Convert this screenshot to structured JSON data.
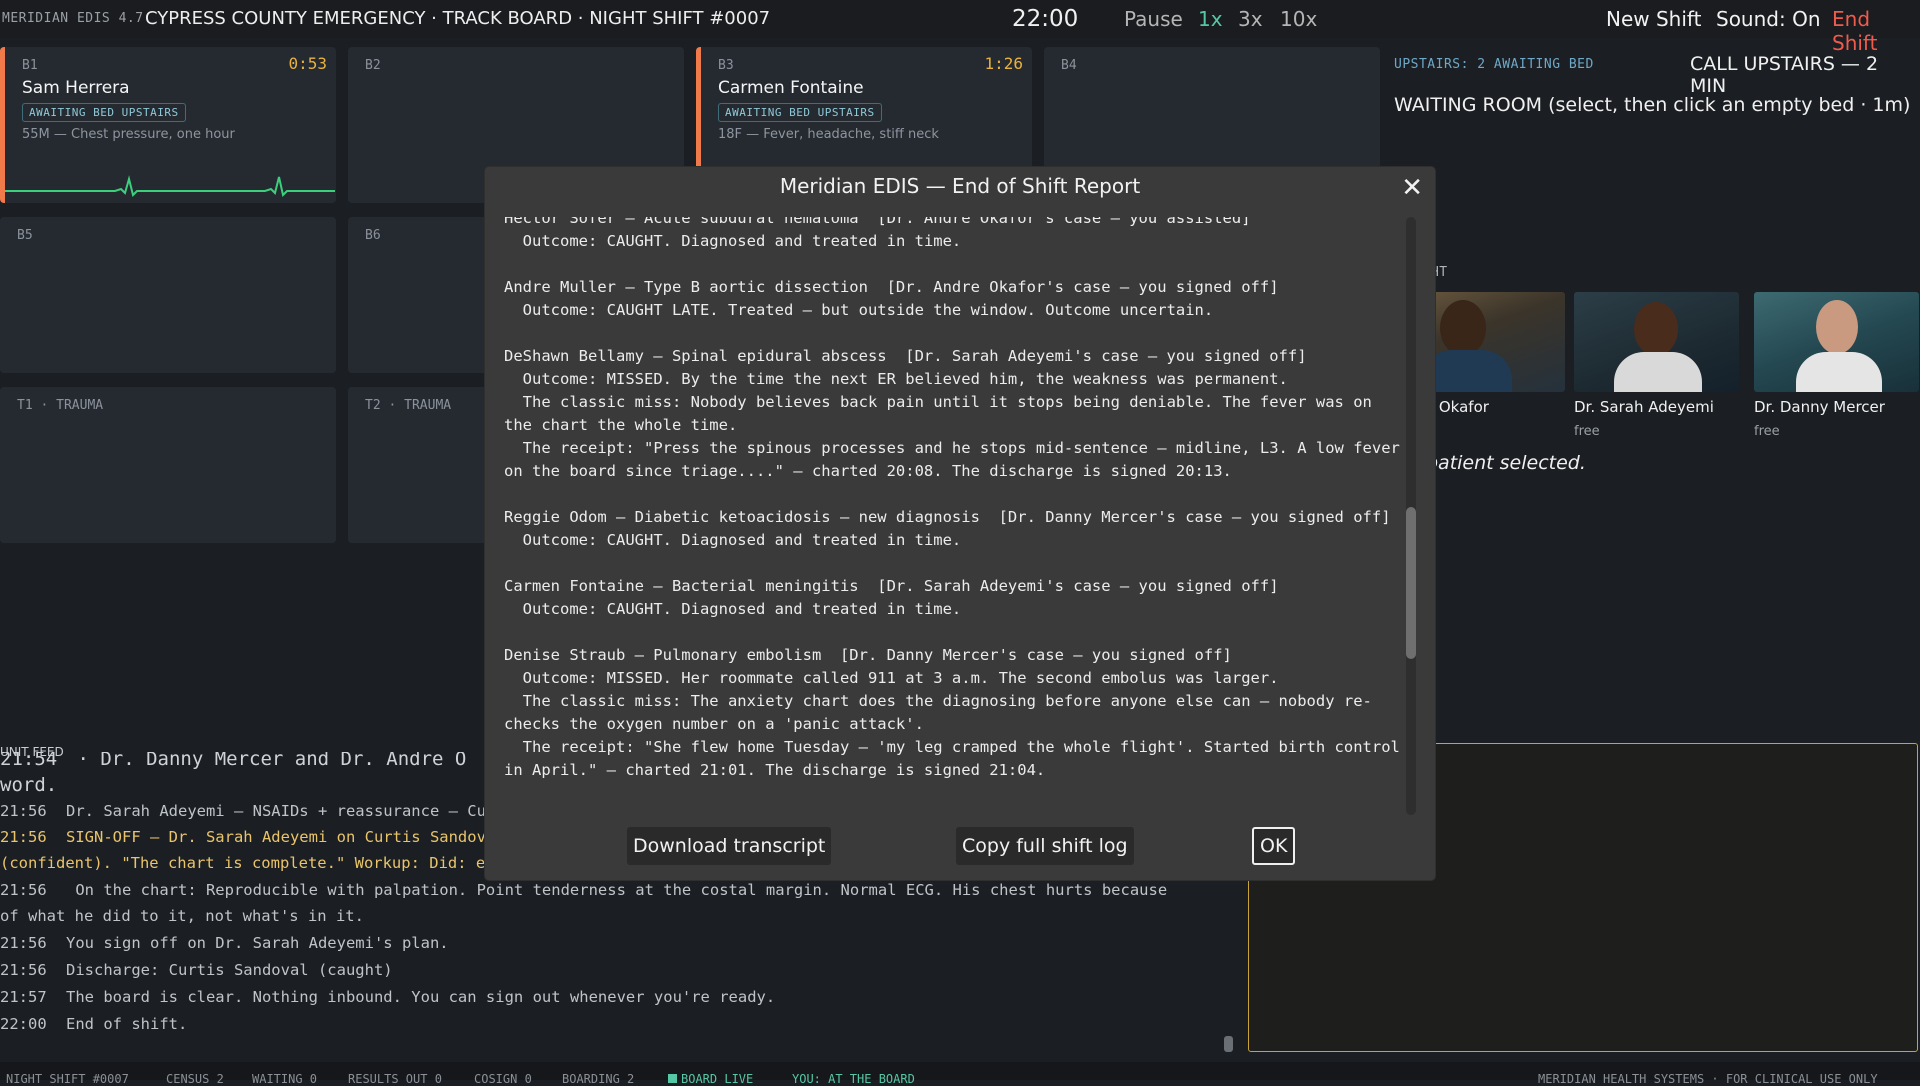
{
  "topbar": {
    "version": "MERIDIAN EDIS 4.7",
    "title": "CYPRESS COUNTY EMERGENCY · TRACK BOARD · NIGHT SHIFT #0007",
    "clock": "22:00",
    "pause": "Pause",
    "speed_1x": "1x",
    "speed_3x": "3x",
    "speed_10x": "10x",
    "new_shift": "New Shift",
    "sound": "Sound: On",
    "end_shift": "End Shift"
  },
  "beds": [
    {
      "code": "B1",
      "timer": "0:53",
      "patient": "Sam Herrera",
      "badge": "AWAITING BED UPSTAIRS",
      "complaint": "55M — Chest pressure, one hour"
    },
    {
      "code": "B2"
    },
    {
      "code": "B3",
      "timer": "1:26",
      "patient": "Carmen Fontaine",
      "badge": "AWAITING BED UPSTAIRS",
      "complaint": "18F — Fever, headache, stiff neck"
    },
    {
      "code": "B4"
    },
    {
      "code": "B5"
    },
    {
      "code": "B6"
    },
    {
      "code": "T1 · TRAUMA"
    },
    {
      "code": "T2 · TRAUMA"
    }
  ],
  "right": {
    "upstairs": "UPSTAIRS: 2 AWAITING BED",
    "call_upstairs": "CALL UPSTAIRS — 2 MIN",
    "waiting_room": "WAITING ROOM  (select, then click an empty bed · 1m)",
    "on_tonight": "NIGHT",
    "doctors": [
      {
        "name": "ndre Okafor",
        "status": ""
      },
      {
        "name": "Dr. Sarah Adeyemi",
        "status": "free"
      },
      {
        "name": "Dr. Danny Mercer",
        "status": "free"
      }
    ],
    "no_selection": "patient selected."
  },
  "feed": {
    "label": "UNIT FEED",
    "lines": [
      {
        "time": "21:54",
        "text": "  · Dr. Danny Mercer and Dr. Andre O"
      },
      {
        "time": "",
        "text": "word."
      },
      {
        "time": "21:56",
        "text": "Dr. Sarah Adeyemi — NSAIDs + reassurance — Cu"
      },
      {
        "time": "21:56",
        "text": "SIGN-OFF — Dr. Sarah Adeyemi on Curtis Sandov"
      },
      {
        "time": "",
        "text": "(confident). \"The chart is complete.\" Workup: Did: e"
      },
      {
        "time": "21:56",
        "text": "    On the chart: Reproducible with palpation. Point tenderness at the costal margin. Normal ECG. His chest hurts because"
      },
      {
        "time": "",
        "text": "of what he did to it, not what's in it."
      },
      {
        "time": "21:56",
        "text": "You sign off on Dr. Sarah Adeyemi's plan."
      },
      {
        "time": "21:56",
        "text": "Discharge: Curtis Sandoval (caught)"
      },
      {
        "time": "21:57",
        "text": "The board is clear. Nothing inbound. You can sign out whenever you're ready."
      },
      {
        "time": "22:00",
        "text": "End of shift."
      }
    ]
  },
  "status": {
    "shift": "NIGHT SHIFT #0007",
    "census": "CENSUS 2",
    "waiting": "WAITING 0",
    "results": "RESULTS OUT 0",
    "cosign": "COSIGN 0",
    "boarding": "BOARDING 2",
    "live": "BOARD LIVE",
    "you": "YOU: AT THE BOARD",
    "brand": "MERIDIAN HEALTH SYSTEMS · FOR CLINICAL USE ONLY"
  },
  "modal": {
    "title": "Meridian EDIS — End of Shift Report",
    "entries": [
      [
        "Hector Sofer — Acute subdural hematoma  [Dr. Andre Okafor's case — you assisted]",
        "  Outcome: CAUGHT. Diagnosed and treated in time."
      ],
      [
        "Andre Muller — Type B aortic dissection  [Dr. Andre Okafor's case — you signed off]",
        "  Outcome: CAUGHT LATE. Treated — but outside the window. Outcome uncertain."
      ],
      [
        "DeShawn Bellamy — Spinal epidural abscess  [Dr. Sarah Adeyemi's case — you signed off]",
        "  Outcome: MISSED. By the time the next ER believed him, the weakness was permanent.",
        "  The classic miss: Nobody believes back pain until it stops being deniable. The fever was on the chart the whole time.",
        "  The receipt: \"Press the spinous processes and he stops mid-sentence — midline, L3. A low fever on the board since triage....\" — charted 20:08. The discharge is signed 20:13."
      ],
      [
        "Reggie Odom — Diabetic ketoacidosis — new diagnosis  [Dr. Danny Mercer's case — you signed off]",
        "  Outcome: CAUGHT. Diagnosed and treated in time."
      ],
      [
        "Carmen Fontaine — Bacterial meningitis  [Dr. Sarah Adeyemi's case — you signed off]",
        "  Outcome: CAUGHT. Diagnosed and treated in time."
      ],
      [
        "Denise Straub — Pulmonary embolism  [Dr. Danny Mercer's case — you signed off]",
        "  Outcome: MISSED. Her roommate called 911 at 3 a.m. The second embolus was larger.",
        "  The classic miss: The anxiety chart does the diagnosing before anyone else can — nobody re-checks the oxygen number on a 'panic attack'.",
        "  The receipt: \"She flew home Tuesday — 'my leg cramped the whole flight'. Started birth control in April.\" — charted 21:01. The discharge is signed 21:04."
      ]
    ],
    "download": "Download transcript",
    "copy": "Copy full shift log",
    "ok": "OK"
  },
  "colors": {
    "accent_teal": "#56c7a6",
    "alert_red": "#ef5b4c",
    "timer_amber": "#e9b23f",
    "occupied_orange": "#f07a4a"
  }
}
